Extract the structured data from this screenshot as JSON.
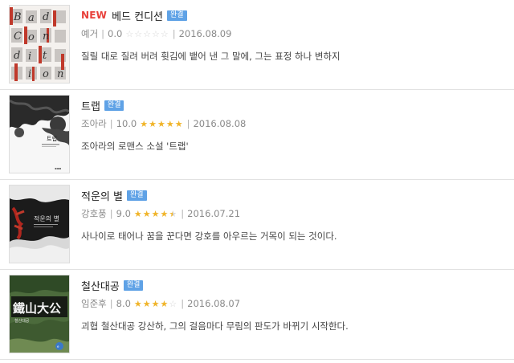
{
  "books": [
    {
      "new_label": "NEW",
      "title": "베드 컨디션",
      "badge": "완결",
      "author": "예거",
      "rating": "0.0",
      "rating_value": 0,
      "date": "2016.08.09",
      "description": "질릴 대로 질려 버려 휫김에 뱉어 낸 그 말에, 그는 표정 하나 변하지",
      "cover_style": "bad-condition",
      "cover_letters": [
        "B",
        "a",
        "d",
        "C",
        "o",
        "n",
        "d",
        "i",
        "t",
        "i",
        "o",
        "n"
      ]
    },
    {
      "new_label": "",
      "title": "트랩",
      "badge": "완결",
      "author": "조아라",
      "rating": "10.0",
      "rating_value": 5,
      "date": "2016.08.08",
      "description": "조아라의 로맨스 소설 '트랩'",
      "cover_style": "trap",
      "cover_title": "트랩"
    },
    {
      "new_label": "",
      "title": "적운의 별",
      "badge": "완결",
      "author": "강호풍",
      "rating": "9.0",
      "rating_value": 4.5,
      "date": "2016.07.21",
      "description": "사나이로 태어나 꿈을 꾼다면 강호를 아우르는 거목이 되는 것이다.",
      "cover_style": "red-star",
      "cover_title": "적운의 별"
    },
    {
      "new_label": "",
      "title": "철산대공",
      "badge": "완결",
      "author": "임준후",
      "rating": "8.0",
      "rating_value": 4,
      "date": "2016.08.07",
      "description": "괴협 철산대공 강산하, 그의 걸음마다 무림의 판도가 바뀌기 시작한다.",
      "cover_style": "iron-mountain",
      "cover_title": "鐵山大公",
      "cover_subtitle": "철산대공"
    }
  ],
  "colors": {
    "accent_new": "#e8413b",
    "badge": "#5fa2e6",
    "star": "#f0b429"
  }
}
